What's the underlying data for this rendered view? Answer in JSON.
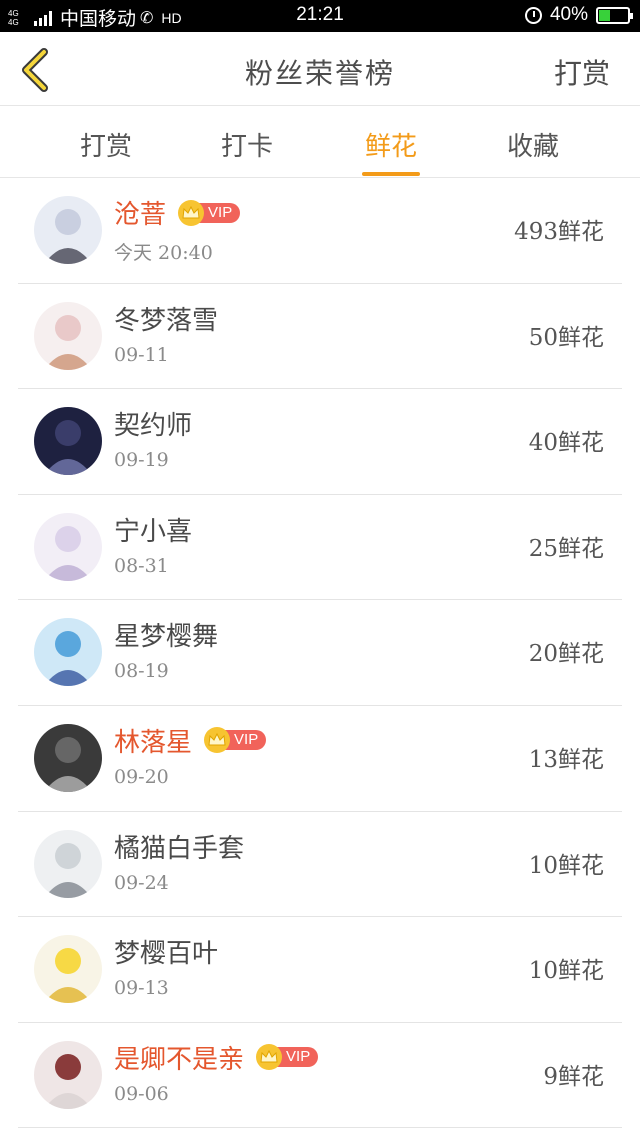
{
  "status_bar": {
    "network": "4G 4G",
    "carrier": "中国移动",
    "hd": "HD",
    "time": "21:21",
    "battery": "40%",
    "battery_level": 0.4
  },
  "header": {
    "title": "粉丝荣誉榜",
    "action": "打赏"
  },
  "tabs": [
    {
      "label": "打赏"
    },
    {
      "label": "打卡"
    },
    {
      "label": "鲜花",
      "active": true
    },
    {
      "label": "收藏"
    }
  ],
  "vip_label": "VIP",
  "colors": {
    "accent": "#f39b19",
    "vip_name": "#e4572e",
    "vip_badge": "#f1635a",
    "crown": "#f7c431"
  },
  "rows": [
    {
      "name": "沧萻",
      "date": "今天 20:40",
      "count": "493鲜花",
      "vip": true
    },
    {
      "name": "冬梦落雪",
      "date": "09-11",
      "count": "50鲜花",
      "vip": false
    },
    {
      "name": "契约师",
      "date": "09-19",
      "count": "40鲜花",
      "vip": false
    },
    {
      "name": "宁小喜",
      "date": "08-31",
      "count": "25鲜花",
      "vip": false
    },
    {
      "name": "星梦樱舞",
      "date": "08-19",
      "count": "20鲜花",
      "vip": false
    },
    {
      "name": "林落星",
      "date": "09-20",
      "count": "13鲜花",
      "vip": true
    },
    {
      "name": "橘猫白手套",
      "date": "09-24",
      "count": "10鲜花",
      "vip": false
    },
    {
      "name": "梦樱百叶",
      "date": "09-13",
      "count": "10鲜花",
      "vip": false
    },
    {
      "name": "是卿不是亲",
      "date": "09-06",
      "count": "9鲜花",
      "vip": true
    }
  ]
}
